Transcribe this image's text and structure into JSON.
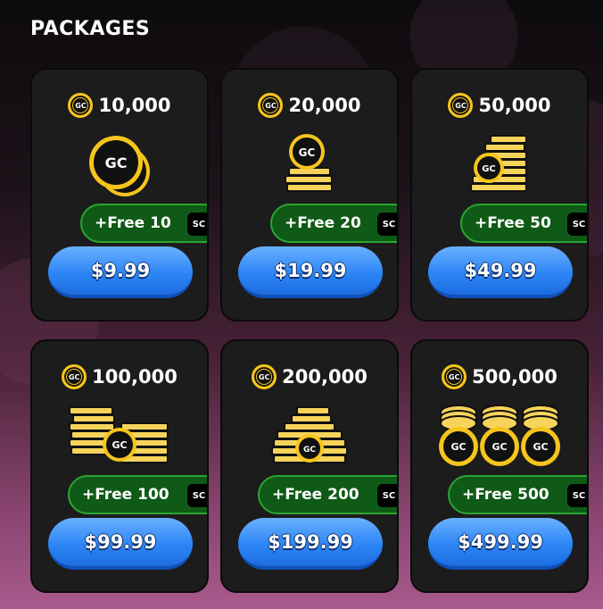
{
  "header": {
    "title": "PACKAGES"
  },
  "coin_label": "GC",
  "sweep_label": "SC",
  "colors": {
    "accent": "#2d86f6",
    "gold": "#f6c51c",
    "free_green": "#0f5a16",
    "card_bg": "#1c1c1c"
  },
  "packages": [
    {
      "amount": "10,000",
      "free": "+Free 10",
      "price": "$9.99",
      "art": "single-coin-icon"
    },
    {
      "amount": "20,000",
      "free": "+Free 20",
      "price": "$19.99",
      "art": "coin-small-stack-icon"
    },
    {
      "amount": "50,000",
      "free": "+Free 50",
      "price": "$49.99",
      "art": "coin-stack-icon"
    },
    {
      "amount": "100,000",
      "free": "+Free 100",
      "price": "$99.99",
      "art": "coin-double-stack-icon"
    },
    {
      "amount": "200,000",
      "free": "+Free 200",
      "price": "$199.99",
      "art": "coin-pyramid-icon"
    },
    {
      "amount": "500,000",
      "free": "+Free 500",
      "price": "$499.99",
      "art": "coin-rows-icon"
    }
  ]
}
